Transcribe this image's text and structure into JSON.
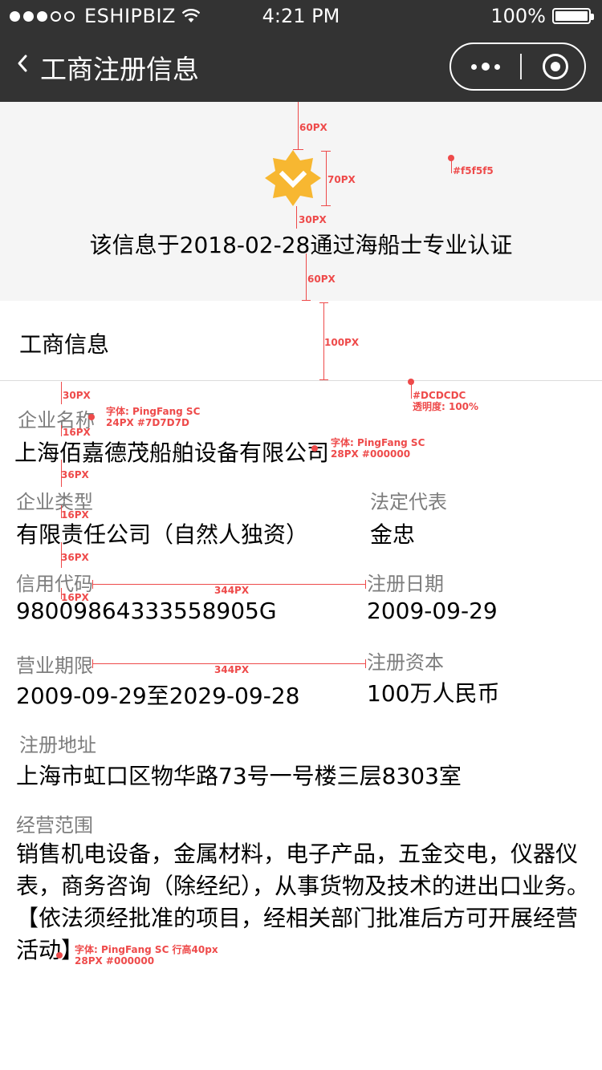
{
  "status_bar": {
    "carrier": "ESHIPBIZ",
    "time": "4:21 PM",
    "battery": "100%"
  },
  "nav": {
    "title": "工商注册信息"
  },
  "verification": {
    "text": "该信息于2018-02-28通过海船士专业认证",
    "badge_color": "#f7b731"
  },
  "section": {
    "title": "工商信息"
  },
  "fields": {
    "company_name_label": "企业名称",
    "company_name_value": "上海佰嘉德茂船舶设备有限公司",
    "company_type_label": "企业类型",
    "company_type_value": "有限责任公司（自然人独资）",
    "legal_rep_label": "法定代表",
    "legal_rep_value": "金忠",
    "credit_code_label": "信用代码",
    "credit_code_value": "98009864333558905G",
    "reg_date_label": "注册日期",
    "reg_date_value": "2009-09-29",
    "term_label": "营业期限",
    "term_value": "2009-09-29至2029-09-28",
    "capital_label": "注册资本",
    "capital_value": "100万人民币",
    "address_label": "注册地址",
    "address_value": "上海市虹口区物华路73号一号楼三层8303室",
    "scope_label": "经营范围",
    "scope_value": "销售机电设备，金属材料，电子产品，五金交电，仪器仪表，商务咨询（除经纪），从事货物及技术的进出口业务。【依法须经批准的项目，经相关部门批准后方可开展经营活动】"
  },
  "annotations": {
    "a_60px_top": "60PX",
    "a_70px": "70PX",
    "a_30px_badge": "30PX",
    "a_bg_color": "#f5f5f5",
    "a_60px_bottom": "60PX",
    "a_100px": "100PX",
    "a_divider_color": "#DCDCDC",
    "a_divider_opacity": "透明度: 100%",
    "a_30px_label": "30PX",
    "a_label_font": "字体: PingFang SC",
    "a_label_size": "24PX #7D7D7D",
    "a_16px_1": "16PX",
    "a_value_font": "字体: PingFang SC",
    "a_value_size": "28PX #000000",
    "a_36px_1": "36PX",
    "a_16px_2": "16PX",
    "a_36px_2": "36PX",
    "a_16px_3": "16PX",
    "a_344px_1": "344PX",
    "a_344px_2": "344PX",
    "a_para_font": "字体: PingFang SC  行高40px",
    "a_para_size": "28PX #000000"
  },
  "colors": {
    "nav_bg": "#333333",
    "banner_bg": "#f5f5f5",
    "divider": "#dcdcdc",
    "label": "#7d7d7d",
    "annotation": "#ee4a4a"
  }
}
